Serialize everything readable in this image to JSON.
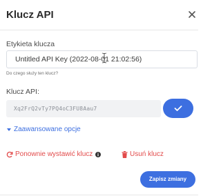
{
  "dialog": {
    "title": "Klucz API",
    "close_icon": "close-icon"
  },
  "name_field": {
    "label": "Etykieta klucza",
    "value": "Untitled API Key (2022-08-01 21:02:56)",
    "help_link": "Do czego służy ten klucz?"
  },
  "api_key": {
    "label": "Klucz API:",
    "value": "Xq2FrQ2vTy7PQ4oC3FU8Aau7",
    "copy_icon": "checkmark-icon"
  },
  "advanced": {
    "label": "Zaawansowane opcje",
    "icon": "caret-down-icon"
  },
  "actions": {
    "reissue_label": "Ponownie wystawić klucz",
    "reissue_icon": "refresh-icon",
    "info_icon": "info-icon",
    "delete_label": "Usuń klucz",
    "delete_icon": "trash-icon",
    "save_label": "Zapisz zmiany"
  },
  "colors": {
    "accent": "#3d6fe0",
    "danger": "#e24b4b"
  }
}
